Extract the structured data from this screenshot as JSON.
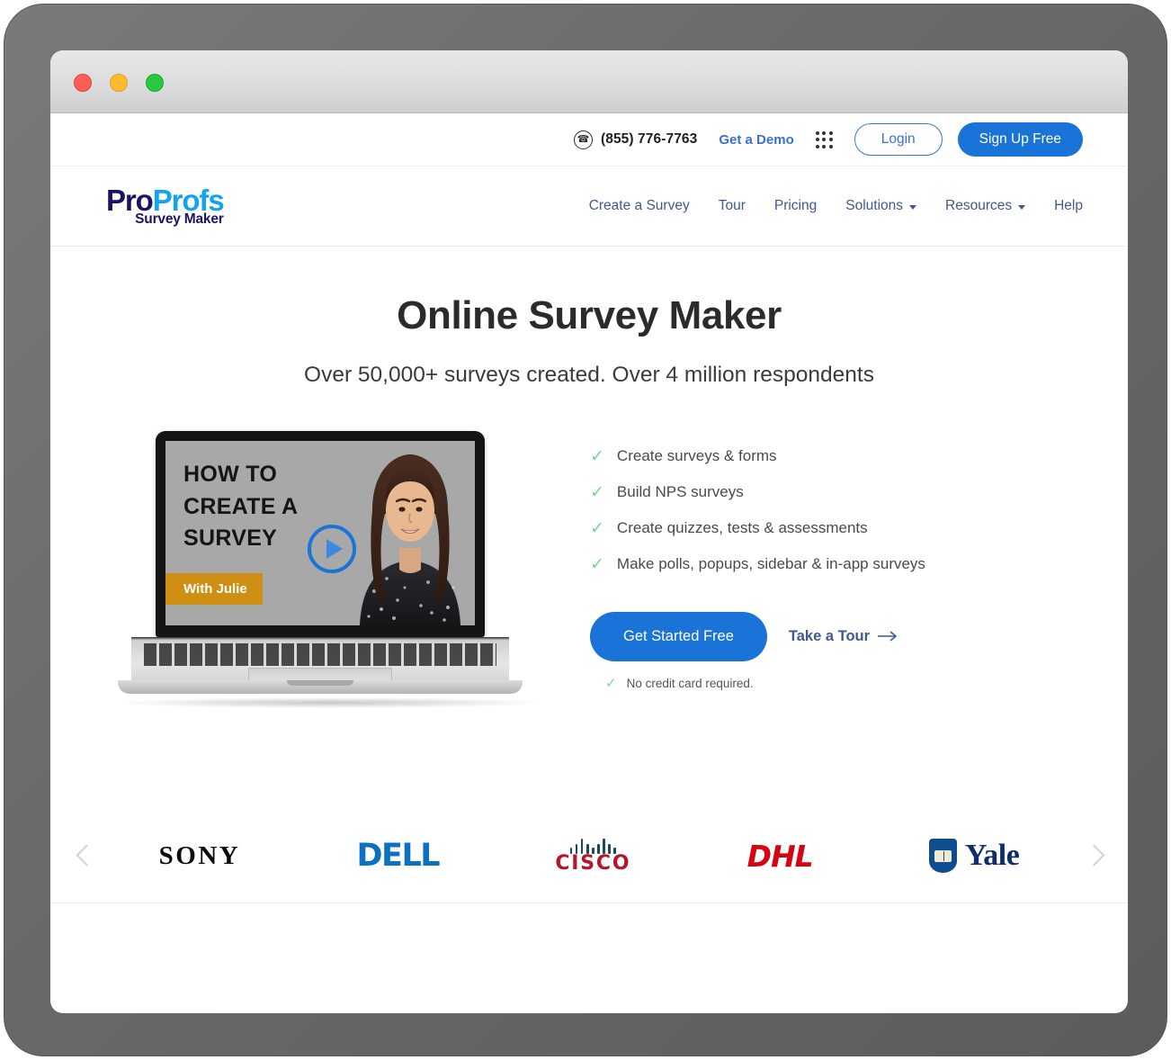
{
  "window": {
    "traffic_lights": [
      "close",
      "minimize",
      "maximize"
    ]
  },
  "utility_bar": {
    "phone_icon": "phone-icon",
    "phone": "(855) 776-7763",
    "demo_link": "Get a Demo",
    "apps_icon": "grid-apps-icon",
    "login_label": "Login",
    "signup_label": "Sign Up Free"
  },
  "brand": {
    "logo_pro": "Pro",
    "logo_profs": "Profs",
    "logo_sub": "Survey Maker",
    "color_navy": "#1b1464",
    "color_cyan": "#12a5ef"
  },
  "nav": {
    "items": [
      {
        "label": "Create a Survey",
        "has_caret": false
      },
      {
        "label": "Tour",
        "has_caret": false
      },
      {
        "label": "Pricing",
        "has_caret": false
      },
      {
        "label": "Solutions",
        "has_caret": true
      },
      {
        "label": "Resources",
        "has_caret": true
      },
      {
        "label": "Help",
        "has_caret": false
      }
    ]
  },
  "hero": {
    "title": "Online Survey Maker",
    "subtitle": "Over 50,000+ surveys created. Over 4 million respondents"
  },
  "video": {
    "line1": "HOW TO",
    "line2": "CREATE A",
    "line3": "SURVEY",
    "badge": "With Julie",
    "play_icon": "play-icon",
    "badge_color": "#cf8f12"
  },
  "features": {
    "items": [
      "Create surveys & forms",
      "Build NPS surveys",
      "Create quizzes, tests & assessments",
      "Make polls, popups, sidebar & in-app surveys"
    ],
    "check_icon": "check-icon",
    "check_color": "#7cd496"
  },
  "cta": {
    "primary_label": "Get Started Free",
    "secondary_label": "Take a Tour",
    "secondary_arrow": "arrow-right-icon",
    "note": "No credit card required.",
    "primary_color": "#1a73d6"
  },
  "carousel": {
    "prev_icon": "chevron-left-icon",
    "next_icon": "chevron-right-icon",
    "logos": [
      {
        "name": "SONY",
        "color": "#0b0b0b"
      },
      {
        "name": "DELL",
        "color": "#0a72c0"
      },
      {
        "name": "CISCO",
        "color": "#b7152c"
      },
      {
        "name": "DHL",
        "color": "#d40511"
      },
      {
        "name": "Yale",
        "color": "#0f2d69"
      }
    ]
  }
}
